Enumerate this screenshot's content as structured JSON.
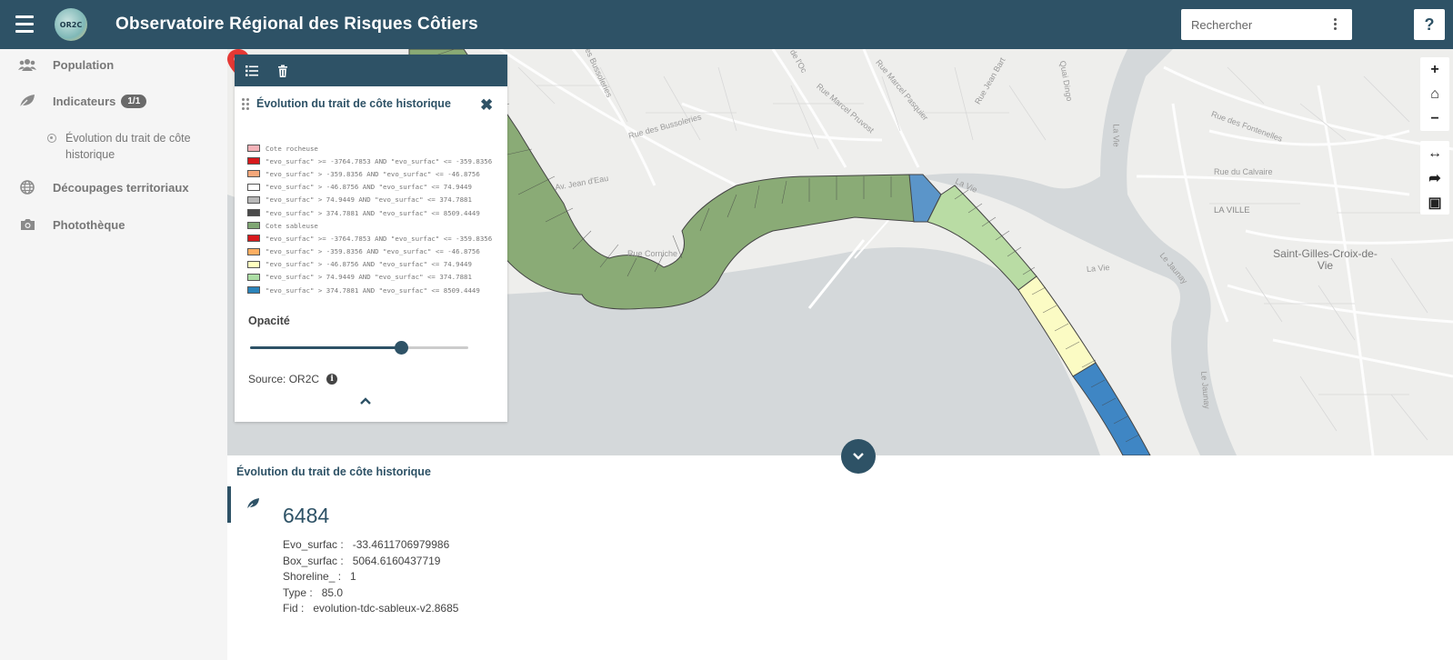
{
  "header": {
    "title": "Observatoire Régional des Risques Côtiers",
    "logo_text": "OR2C",
    "search_placeholder": "Rechercher",
    "help_label": "?"
  },
  "sidebar": {
    "items": [
      {
        "label": "Population",
        "icon": "users-icon"
      },
      {
        "label": "Indicateurs",
        "icon": "leaf-icon",
        "badge": "1/1"
      },
      {
        "label": "Découpages territoriaux",
        "icon": "globe-icon"
      },
      {
        "label": "Photothèque",
        "icon": "camera-icon"
      }
    ],
    "sub_item": "Évolution du trait de côte historique"
  },
  "map": {
    "labels": [
      "Rue des Bussoleries",
      "Rue des Bussoleries",
      "Rue Marcel Pasquier",
      "Rue Jean Bart",
      "Quai Dingo",
      "Rue de l'Oc",
      "Av. Jean d'Eau",
      "Rue Marcel Pruvost",
      "La Vie",
      "La Vie",
      "Rue des Fontenelles",
      "Rue du Calvaire",
      "LA VILLE",
      "La Vie",
      "Le Jaunay",
      "Rue Corniche",
      "Le Jaunay"
    ],
    "city_label": "Saint-Gilles-Croix-de-Vie",
    "controls": [
      "+",
      "⌂",
      "−",
      "↔",
      "➦",
      "▣"
    ]
  },
  "legend_panel": {
    "title": "Évolution du trait de côte historique",
    "close_label": "✖",
    "legend": [
      {
        "label": "Cote rocheuse",
        "color": "#f4b2b8"
      },
      {
        "label": "\"evo_surfac\" >= -3764.7853 AND \"evo_surfac\" <= -359.8356",
        "color": "#d7191c"
      },
      {
        "label": "\"evo_surfac\" > -359.8356 AND \"evo_surfac\" <= -46.8756",
        "color": "#f4a77a"
      },
      {
        "label": "\"evo_surfac\" > -46.8756 AND \"evo_surfac\" <= 74.9449",
        "color": "#ffffff"
      },
      {
        "label": "\"evo_surfac\" > 74.9449 AND \"evo_surfac\" <= 374.7881",
        "color": "#b8b8b8"
      },
      {
        "label": "\"evo_surfac\" > 374.7881 AND \"evo_surfac\" <= 8509.4449",
        "color": "#4a4a4a"
      },
      {
        "label": "Cote sableuse",
        "color": "#7fa673"
      },
      {
        "label": "\"evo_surfac\" >= -3764.7853 AND \"evo_surfac\" <= -359.8356",
        "color": "#d7191c"
      },
      {
        "label": "\"evo_surfac\" > -359.8356 AND \"evo_surfac\" <= -46.8756",
        "color": "#fdae61"
      },
      {
        "label": "\"evo_surfac\" > -46.8756 AND \"evo_surfac\" <= 74.9449",
        "color": "#ffffbf"
      },
      {
        "label": "\"evo_surfac\" > 74.9449 AND \"evo_surfac\" <= 374.7881",
        "color": "#abdda4"
      },
      {
        "label": "\"evo_surfac\" > 374.7881 AND \"evo_surfac\" <= 8509.4449",
        "color": "#2b83ba"
      }
    ],
    "opacity_label": "Opacité",
    "opacity_value": 0.69,
    "source_label": "Source: OR2C"
  },
  "detail": {
    "title": "Évolution du trait de côte historique",
    "id": "6484",
    "attributes": [
      {
        "key": "Evo_surfac :",
        "value": "-33.4611706979986"
      },
      {
        "key": "Box_surfac :",
        "value": "5064.6160437719"
      },
      {
        "key": "Shoreline_ :",
        "value": "1"
      },
      {
        "key": "Type :",
        "value": "85.0"
      },
      {
        "key": "Fid :",
        "value": "evolution-tdc-sableux-v2.8685"
      }
    ]
  },
  "colors": {
    "primary": "#2e5266",
    "marker": "#e53935"
  }
}
